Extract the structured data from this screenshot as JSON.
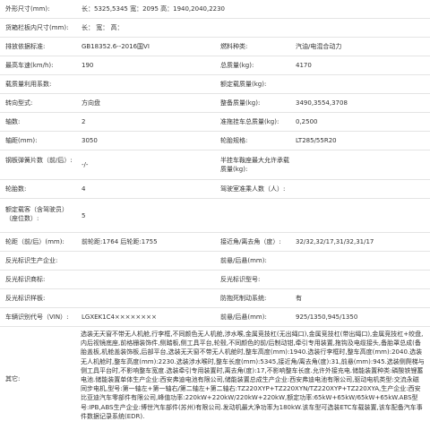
{
  "rows": [
    {
      "l1": "外形尺寸(mm):",
      "v1": "长：5325,5345 宽：2095 高：1940,2040,2230"
    },
    {
      "l1": "货箱栏板内尺寸(mm):",
      "v1": "长： 宽： 高："
    },
    {
      "l1": "排放依据标准:",
      "v1": "GB18352.6--2016国VI",
      "l2": "燃料种类:",
      "v2": "汽油/电混合动力"
    },
    {
      "l1": "最高车速(km/h):",
      "v1": "190",
      "l2": "总质量(kg):",
      "v2": "4170"
    },
    {
      "l1": "载质量利用系数:",
      "v1": "",
      "l2": "额定载质量(kg):",
      "v2": ""
    },
    {
      "l1": "转向型式:",
      "v1": "方向盘",
      "l2": "整备质量(kg):",
      "v2": "3490,3554,3708"
    },
    {
      "l1": "轴数:",
      "v1": "2",
      "l2": "准拖挂车总质量(kg):",
      "v2": "0,2500"
    },
    {
      "l1": "轴距(mm):",
      "v1": "3050",
      "l2": "轮胎规格:",
      "v2": "LT285/55R20"
    },
    {
      "l1": "钢板弹簧片数（前/后）:",
      "v1": "-/-",
      "l2": "半挂车鞍座最大允许承载质量(kg):",
      "v2": ""
    },
    {
      "l1": "轮胎数:",
      "v1": "4",
      "l2": "驾驶室准乘人数（人）:",
      "v2": ""
    },
    {
      "l1": "额定载客（含驾驶员）（座位数）:",
      "v1": "5",
      "l2": "",
      "v2": ""
    },
    {
      "l1": "轮距（前/后）(mm):",
      "v1": "前轮距:1764 后轮距:1755",
      "l2": "接近角/离去角（度）:",
      "v2": "32/32,32/17,31/32,31/17"
    },
    {
      "l1": "反光标识生产企业:",
      "v1": "",
      "l2": "前悬/后悬(mm):",
      "v2": ""
    },
    {
      "l1": "反光标识商标:",
      "v1": "",
      "l2": "反光标识型号:",
      "v2": ""
    },
    {
      "l1": "反光标识样板:",
      "v1": "",
      "l2": "防抱死制动系统:",
      "v2": "有"
    },
    {
      "l1": "车辆识别代号（VIN）:",
      "v1": "LGXEK1C4××××××××",
      "l2": "前悬/后悬(mm):",
      "v2": "925/1350,945/1350"
    }
  ],
  "other": {
    "label": "其它:",
    "text": "选装无天窗不带无人机舱,行李框,不同颜色无人机舱,涉水喉,金属竞技杠(无出绳口),金属竞技杠(带出绳口),金属竞技杠+绞盘,内后视镜底座,前格栅装饰件,侧踏板,侧工具平台,轮毂,不同颜色的前/后制动钳,牵引专用装置,拖钩及电缆接头,备胎罩总成(备胎盖板,机舱盖装饰板,后部平台,选装无天窗不带无人机舱时,整车高度(mm):1940.选装行李框时,整车高度(mm):2040.选装无人机舱时,整车高度(mm):2230.选装涉水喉时,整车长度(mm):5345,接近角/离去角(度):31,前悬(mm):945.选装侧爬梯与侧工具平台时,不影响整车宽度.选装牵引专用装置时,离去角(度):17,不影响整车长度.允许外接充电.储能装置种类:磷酸铁锂蓄电池.储能装置单体生产企业:西安弗迪电池有限公司,储能装置总成生产企业:西安弗迪电池有限公司,驱动电机类型:交流永磁同步电机,型号:第一轴左+第一轴右/第二轴左+第二轴右:TZ220XYP+TZ220XYN/TZ220XYP+TZ220XYA,生产企业:西安比亚迪汽车零部件有限公司,峰值功率:220kW+220kW/220kW+220kW,额定功率:65kW+65kW/65kW+65kW.ABS型号:IPB,ABS生产企业:博世汽车部件(苏州)有限公司.发动机最大净功率为180kW.该车型可选装ETC车载装置,该车配备汽车事件数据记录系统(EDR)."
  }
}
